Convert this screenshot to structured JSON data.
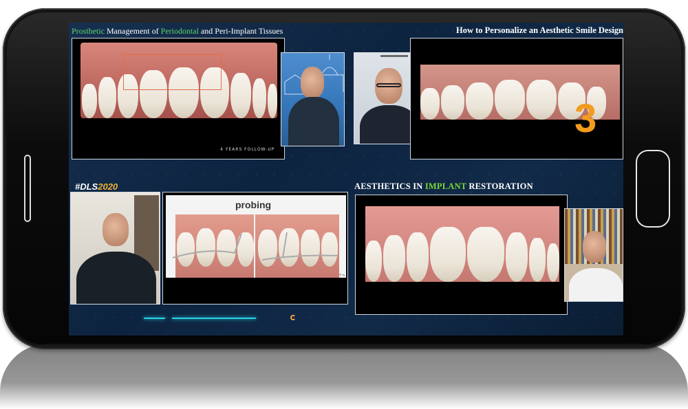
{
  "top_left_panel": {
    "title_prefix": "Prosthetic",
    "title_mid1": " Management of ",
    "title_green": "Periodontal",
    "title_mid2": " and Peri-Implant Tissues",
    "slide_caption": "4 YEARS FOLLOW-UP"
  },
  "top_right_panel": {
    "title": "How to Personalize an Aesthetic Smile Design",
    "big_number": "3"
  },
  "bottom_left_panel": {
    "hashtag_prefix": "#DLS",
    "hashtag_year": "2020",
    "slide_title": "probing",
    "slide_corner_text": "7 n"
  },
  "bottom_right_panel": {
    "title_prefix": "AESTHETICS IN ",
    "title_green": "IMPLANT",
    "title_suffix": " RESTORATION"
  },
  "icons": [
    "speaker-slot-icon",
    "home-button-icon",
    "loading-spinner-icon"
  ],
  "colors": {
    "accent_green": "#5ed26a",
    "accent_orange": "#f39b1c",
    "glow_cyan": "#27d6e6",
    "hashtag_yellow": "#f2b233"
  }
}
